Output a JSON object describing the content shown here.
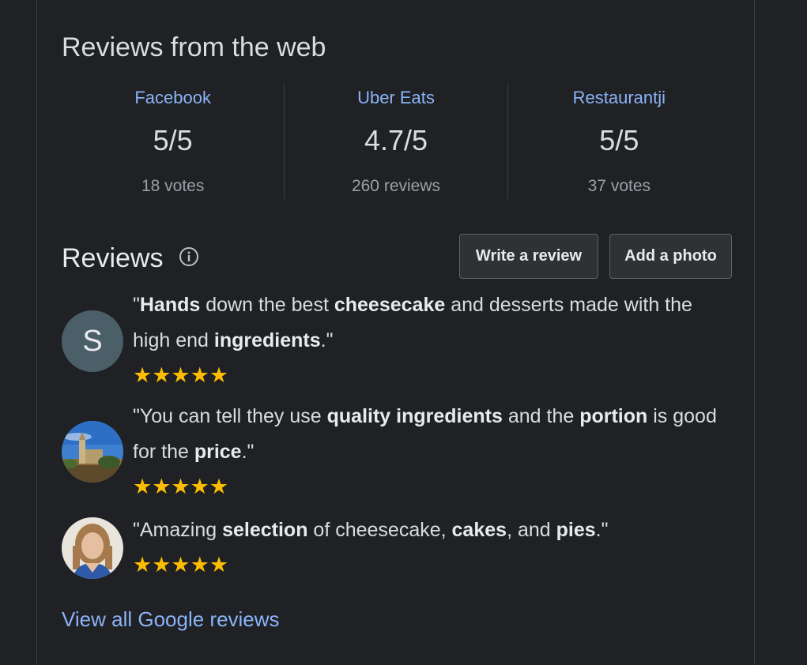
{
  "web_reviews": {
    "title": "Reviews from the web",
    "sources": [
      {
        "name": "Facebook",
        "score": "5/5",
        "count": "18 votes"
      },
      {
        "name": "Uber Eats",
        "score": "4.7/5",
        "count": "260 reviews"
      },
      {
        "name": "Restaurantji",
        "score": "5/5",
        "count": "37 votes"
      }
    ]
  },
  "reviews": {
    "heading": "Reviews",
    "info_icon": "info-icon",
    "write_review_label": "Write a review",
    "add_photo_label": "Add a photo",
    "items": [
      {
        "avatar_letter": "S",
        "avatar_color": "#4a5f68",
        "text_parts": [
          "\"",
          "Hands",
          " down the best ",
          "cheesecake",
          " and desserts made with the high end ",
          "ingredients",
          ".\""
        ],
        "stars": "★★★★★",
        "rating": 5
      },
      {
        "avatar_kind": "photo-landscape",
        "text_parts": [
          "\"You can tell they use ",
          "quality ingredients",
          " and the ",
          "portion",
          " is good for the ",
          "price",
          ".\""
        ],
        "stars": "★★★★★",
        "rating": 5
      },
      {
        "avatar_kind": "photo-person",
        "text_parts": [
          "\"Amazing ",
          "selection",
          " of cheesecake, ",
          "cakes",
          ", and ",
          "pies",
          ".\""
        ],
        "stars": "★★★★★",
        "rating": 5
      }
    ],
    "view_all_label": "View all Google reviews"
  },
  "colors": {
    "background": "#202124",
    "link": "#8ab4f8",
    "star": "#fbbc04",
    "divider": "#3c4043"
  }
}
